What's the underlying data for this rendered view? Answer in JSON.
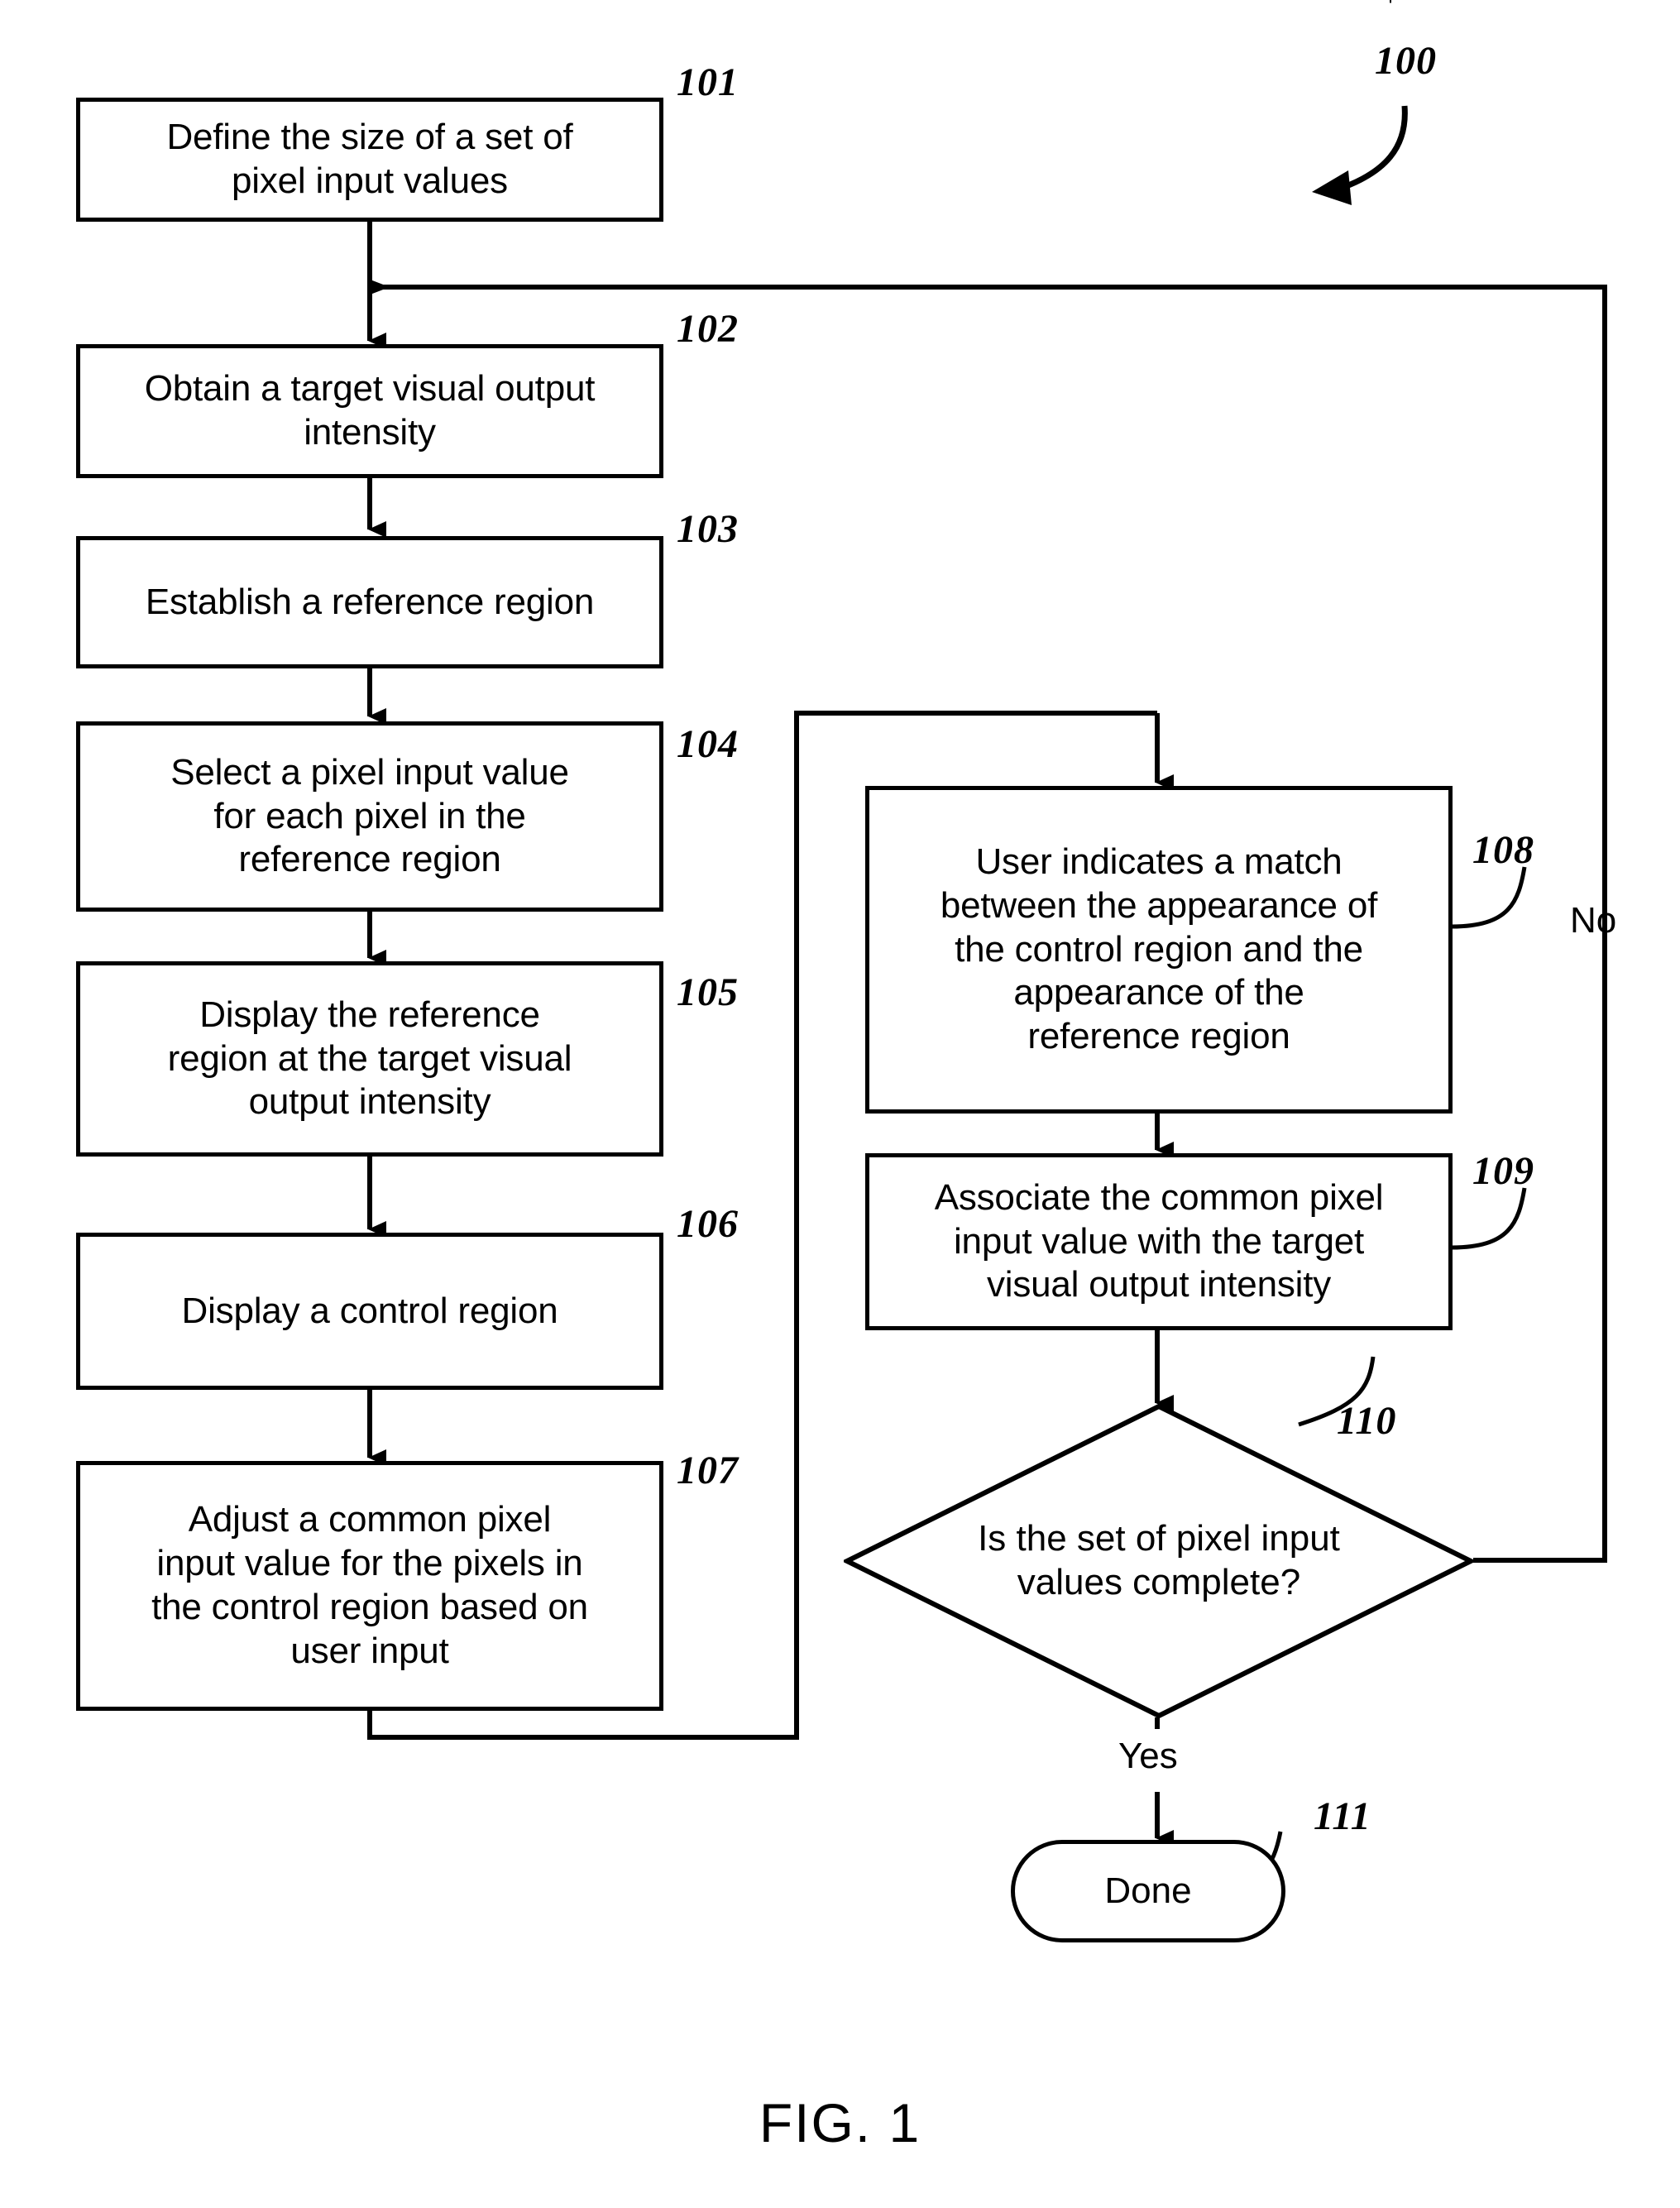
{
  "figure": {
    "caption": "FIG. 1",
    "diagram_numeral": "100"
  },
  "nodes": [
    {
      "id": "101",
      "numeral": "101",
      "shape": "process",
      "text": "Define the size of a set of\npixel input values"
    },
    {
      "id": "102",
      "numeral": "102",
      "shape": "process",
      "text": "Obtain a target visual output\nintensity"
    },
    {
      "id": "103",
      "numeral": "103",
      "shape": "process",
      "text": "Establish a reference region"
    },
    {
      "id": "104",
      "numeral": "104",
      "shape": "process",
      "text": "Select a pixel input value\nfor each pixel in the\nreference region"
    },
    {
      "id": "105",
      "numeral": "105",
      "shape": "process",
      "text": "Display the reference\nregion at the target visual\noutput intensity"
    },
    {
      "id": "106",
      "numeral": "106",
      "shape": "process",
      "text": "Display a control region"
    },
    {
      "id": "107",
      "numeral": "107",
      "shape": "process",
      "text": "Adjust a common pixel\ninput value for the pixels in\nthe control region based on\nuser input"
    },
    {
      "id": "108",
      "numeral": "108",
      "shape": "process",
      "text": "User indicates a match\nbetween the appearance of\nthe control region and the\nappearance of the\nreference region"
    },
    {
      "id": "109",
      "numeral": "109",
      "shape": "process",
      "text": "Associate the common pixel\ninput value with the target\nvisual output intensity"
    },
    {
      "id": "110",
      "numeral": "110",
      "shape": "decision",
      "text": "Is the set of pixel input\nvalues complete?"
    },
    {
      "id": "111",
      "numeral": "111",
      "shape": "terminal",
      "text": "Done"
    }
  ],
  "edge_labels": {
    "no": "No",
    "yes": "Yes"
  },
  "colors": {
    "stroke": "#000000",
    "fill": "#ffffff"
  }
}
